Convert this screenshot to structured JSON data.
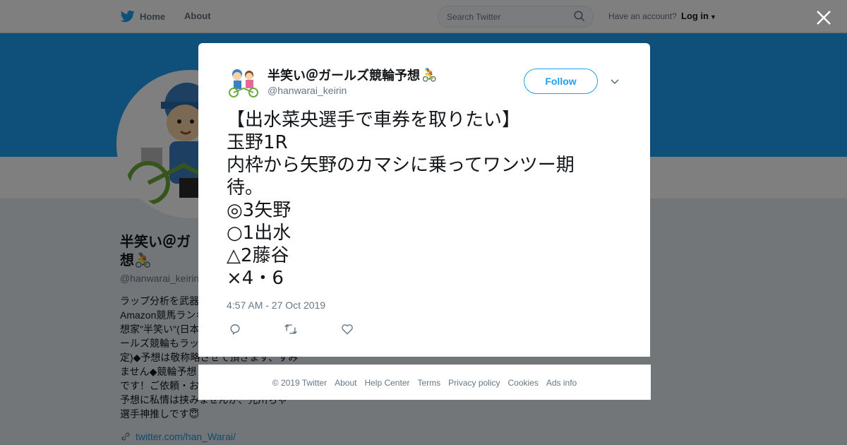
{
  "topbar": {
    "home_label": "Home",
    "about_label": "About",
    "search_placeholder": "Search Twitter",
    "account_prompt": "Have an account?",
    "login_label": "Log in"
  },
  "profile": {
    "name": "半笑い＠ガールズ競輪予想🚴",
    "name_visible_line1": "半笑い＠ガ",
    "name_visible_line2": "想",
    "handle": "@hanwarai_keirin",
    "bio_lines": [
      "ラップ分析を武器",
      "Amazon競馬ランキ",
      "想家\"半笑い\"(日本",
      "ールズ競輪もラッ",
      "定)◆予想は敬称略させて頂きます、すみ",
      "ません◆競輪予想",
      "です！ご依頼・お",
      "予想に私情は挟みませんが、元川ちゃ",
      "選手神推しです😇"
    ],
    "link": "twitter.com/han_Warai/"
  },
  "tweet": {
    "author_name": "半笑い＠ガールズ競輪予想",
    "handle": "@hanwarai_keirin",
    "follow_label": "Follow",
    "text_lines": [
      "【出水菜央選手で車券を取りたい】",
      "玉野1R",
      "内枠から矢野のカマシに乗ってワンツー期",
      "待。",
      "◎3矢野",
      "○1出水",
      "△2藤谷",
      "×4・6"
    ],
    "timestamp": "4:57 AM - 27 Oct 2019",
    "actions": [
      "reply-icon",
      "retweet-icon",
      "like-icon"
    ]
  },
  "footer": {
    "links": [
      "© 2019 Twitter",
      "About",
      "Help Center",
      "Terms",
      "Privacy policy",
      "Cookies",
      "Ads info"
    ]
  },
  "colors": {
    "brand": "#1da1f2",
    "overlay": "rgba(0,0,0,0.5)",
    "text": "#14171a",
    "muted": "#657786"
  }
}
